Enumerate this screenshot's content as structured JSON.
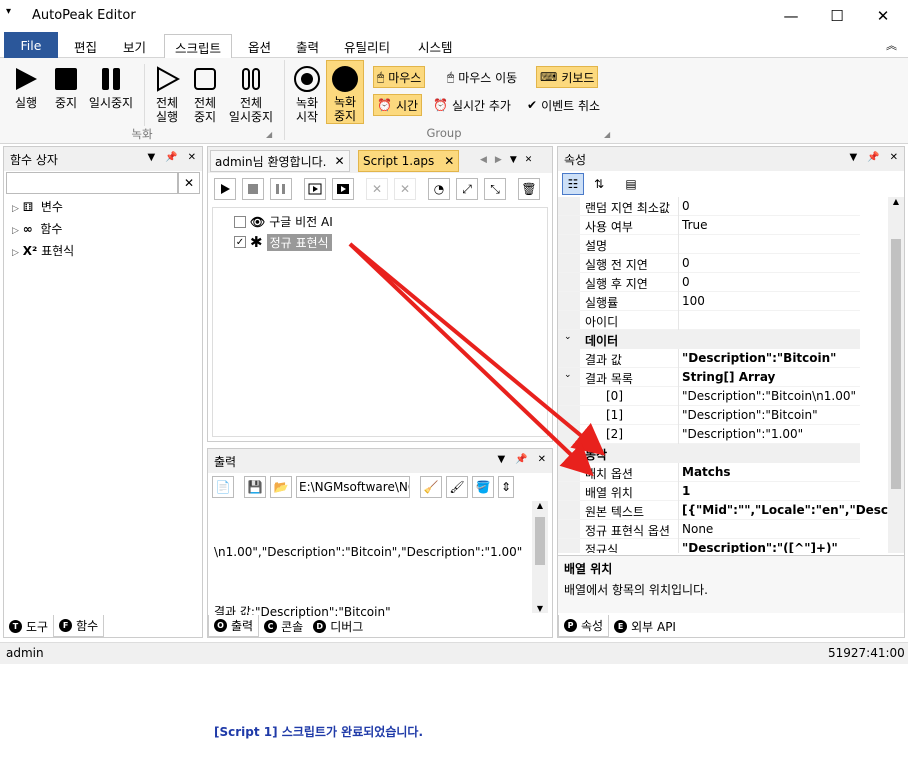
{
  "app": {
    "title": "AutoPeak Editor"
  },
  "menu": {
    "file": "File",
    "tabs": [
      "편집",
      "보기",
      "스크립트",
      "옵션",
      "출력",
      "유틸리티",
      "시스템"
    ]
  },
  "ribbon": {
    "run": "실행",
    "stop": "중지",
    "pause": "일시중지",
    "run_all": "전체\n실행",
    "stop_all": "전체\n중지",
    "pause_all": "전체\n일시중지",
    "rec_start": "녹화\n시작",
    "rec_stop": "녹화\n중지",
    "mouse": "마우스",
    "mouse_move": "마우스 이동",
    "keyboard": "키보드",
    "time": "시간",
    "realtime_add": "실시간 추가",
    "event_cancel": "이벤트 취소",
    "group_record": "녹화",
    "group_group": "Group"
  },
  "toolbox": {
    "title": "함수 상자",
    "items": [
      "변수",
      "함수",
      "표현식"
    ],
    "tabs": [
      "도구",
      "함수"
    ]
  },
  "editor": {
    "tabs": [
      "admin님 환영합니다.",
      "Script 1.aps"
    ],
    "nodes": [
      {
        "label": "구글 비전 AI",
        "checked": false
      },
      {
        "label": "정규 표현식",
        "checked": true
      }
    ]
  },
  "output": {
    "title": "출력",
    "path": "E:\\NGMsoftware\\NG",
    "lines": [
      "\\n1.00\",\"Description\":\"Bitcoin\",\"Description\":\"1.00\"",
      "결과 값:\"Description\":\"Bitcoin\"",
      "",
      "[Script 1] 스크립트가 완료되었습니다."
    ],
    "tabs": [
      "출력",
      "콘솔",
      "디버그"
    ]
  },
  "properties": {
    "title": "속성",
    "rows": [
      {
        "k": "랜덤 지연 최소값",
        "v": "0"
      },
      {
        "k": "사용 여부",
        "v": "True"
      },
      {
        "k": "설명",
        "v": ""
      },
      {
        "k": "실행 전 지연",
        "v": "0"
      },
      {
        "k": "실행 후 지연",
        "v": "0"
      },
      {
        "k": "실행률",
        "v": "100"
      },
      {
        "k": "아이디",
        "v": ""
      },
      {
        "k": "데이터",
        "v": "",
        "cat": true
      },
      {
        "k": "결과 값",
        "v": "\"Description\":\"Bitcoin\"",
        "bold": true
      },
      {
        "k": "결과 목록",
        "v": "String[] Array",
        "bold": true,
        "expand": true
      },
      {
        "k": "[0]",
        "v": "\"Description\":\"Bitcoin\\n1.00\"",
        "indent": true
      },
      {
        "k": "[1]",
        "v": "\"Description\":\"Bitcoin\"",
        "indent": true
      },
      {
        "k": "[2]",
        "v": "\"Description\":\"1.00\"",
        "indent": true
      },
      {
        "k": "동작",
        "v": "",
        "cat": true
      },
      {
        "k": "매치 옵션",
        "v": "Matchs",
        "bold": true
      },
      {
        "k": "배열 위치",
        "v": "1",
        "bold": true
      },
      {
        "k": "원본 텍스트",
        "v": "[{\"Mid\":\"\",\"Locale\":\"en\",\"Descriptio",
        "bold": true
      },
      {
        "k": "정규 표현식 옵션",
        "v": "None"
      },
      {
        "k": "정규식",
        "v": "\"Description\":\"([^\"]+)\"",
        "bold": true
      }
    ],
    "desc_title": "배열 위치",
    "desc_text": "배열에서 항목의 위치입니다.",
    "tabs": [
      "속성",
      "외부 API"
    ]
  },
  "status": {
    "user": "admin",
    "time": "51927:41:00"
  },
  "colors": {
    "file_tab": "#2b579a",
    "highlight": "#fcd97e",
    "arrow": "#e8211d",
    "output_blue": "#1f3aa8"
  }
}
